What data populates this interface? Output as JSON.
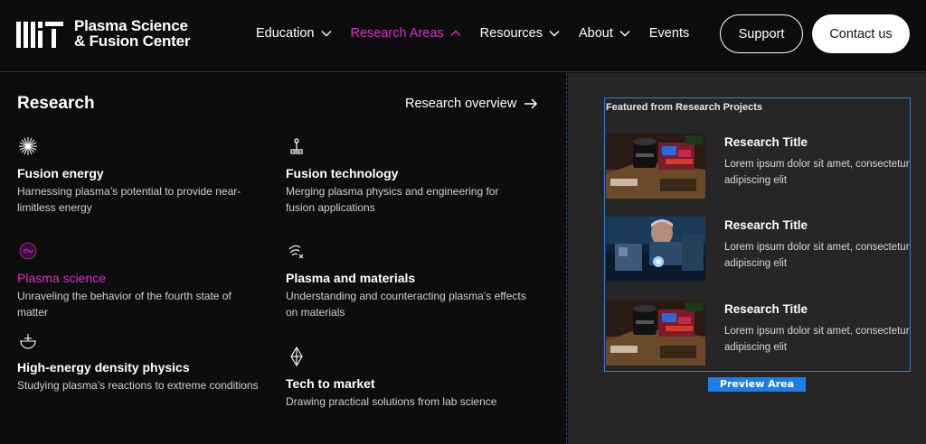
{
  "header": {
    "logo_alt": "MIT",
    "logo_line1": "Plasma Science",
    "logo_line2": "& Fusion Center",
    "nav": [
      {
        "label": "Education",
        "active": false,
        "has_dropdown": true
      },
      {
        "label": "Research Areas",
        "active": true,
        "has_dropdown": true
      },
      {
        "label": "Resources",
        "active": false,
        "has_dropdown": true
      },
      {
        "label": "About",
        "active": false,
        "has_dropdown": true
      },
      {
        "label": "Events",
        "active": false,
        "has_dropdown": false
      }
    ],
    "support_label": "Support",
    "contact_label": "Contact us"
  },
  "menu": {
    "title": "Research",
    "overview_label": "Research overview",
    "items": [
      {
        "title": "Fusion energy",
        "desc": "Harnessing plasma’s potential to provide near-limitless energy",
        "icon": "starburst-icon",
        "highlight": false
      },
      {
        "title": "Fusion technology",
        "desc": "Merging plasma physics and engineering for fusion applications",
        "icon": "lamp-icon",
        "highlight": false
      },
      {
        "title": "Plasma science",
        "desc": "Unraveling the behavior of the fourth state of matter",
        "icon": "plasma-orb-icon",
        "highlight": true
      },
      {
        "title": "Plasma and materials",
        "desc": "Understanding and counteracting plasma’s effects on materials",
        "icon": "signal-waves-icon",
        "highlight": false
      },
      {
        "title": "High-energy density physics",
        "desc": "Studying plasma’s reactions to extreme conditions",
        "icon": "globe-burst-icon",
        "highlight": false
      },
      {
        "title": "Tech to market",
        "desc": "Drawing practical solutions from lab science",
        "icon": "diamond-icon",
        "highlight": false
      }
    ]
  },
  "featured": {
    "label": "Featured from Research Projects",
    "projects": [
      {
        "title": "Research Title",
        "desc_line1": "Lorem ipsum dolor sit amet, consectetur",
        "desc_line2": "adipiscing elit"
      },
      {
        "title": "Research Title",
        "desc_line1": "Lorem ipsum dolor sit amet, consectetur",
        "desc_line2": "adipiscing elit"
      },
      {
        "title": "Research Title",
        "desc_line1": "Lorem ipsum dolor sit amet, consectetur",
        "desc_line2": "adipiscing elit"
      }
    ],
    "preview_label": "Preview Area"
  },
  "colors": {
    "accent_pink": "#d631c8",
    "preview_blue": "#1d7ee6",
    "background": "#0d0d0d",
    "panel_gray": "#262626"
  }
}
